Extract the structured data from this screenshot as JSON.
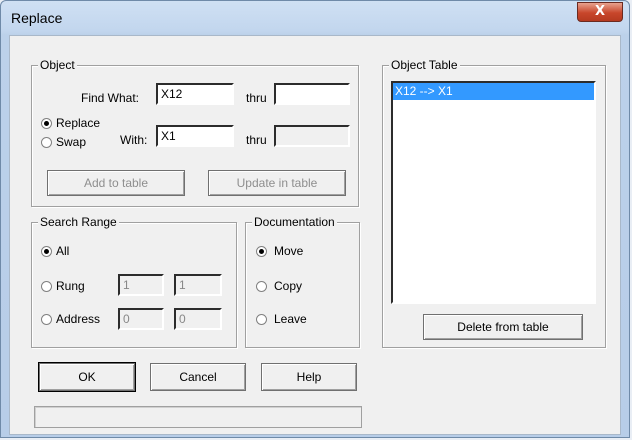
{
  "window": {
    "title": "Replace",
    "close_glyph": "X"
  },
  "object": {
    "group_label": "Object",
    "find_what_label": "Find What:",
    "find_what_value": "X12",
    "thru_label_1": "thru",
    "thru_value_1": "",
    "replace_label": "Replace",
    "swap_label": "Swap",
    "with_label": "With:",
    "with_value": "X1",
    "thru_label_2": "thru",
    "thru_value_2": "",
    "mode_selected": "Replace",
    "add_button": "Add to table",
    "update_button": "Update in table"
  },
  "search_range": {
    "group_label": "Search Range",
    "all_label": "All",
    "rung_label": "Rung",
    "rung_from": "1",
    "rung_to": "1",
    "address_label": "Address",
    "address_from": "0",
    "address_to": "0",
    "selected": "All"
  },
  "documentation": {
    "group_label": "Documentation",
    "move_label": "Move",
    "copy_label": "Copy",
    "leave_label": "Leave",
    "selected": "Move"
  },
  "object_table": {
    "group_label": "Object Table",
    "items": [
      "X12 --> X1"
    ],
    "delete_button": "Delete from table"
  },
  "buttons": {
    "ok": "OK",
    "cancel": "Cancel",
    "help": "Help"
  },
  "status_text": ""
}
